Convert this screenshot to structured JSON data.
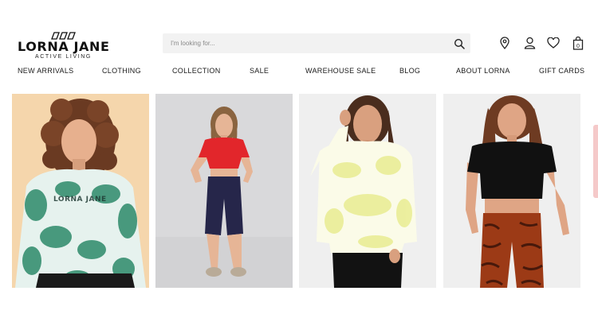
{
  "brand": {
    "name": "LORNA JANE",
    "tagline": "ACTIVE LIVING"
  },
  "search": {
    "placeholder": "I'm looking for..."
  },
  "header_icons": [
    "location-pin-icon",
    "account-icon",
    "heart-icon",
    "bag-icon"
  ],
  "bag": {
    "count": "0"
  },
  "nav": {
    "items": [
      {
        "label": "NEW ARRIVALS"
      },
      {
        "label": "CLOTHING"
      },
      {
        "label": "COLLECTION"
      },
      {
        "label": "SALE"
      },
      {
        "label": "WAREHOUSE SALE"
      },
      {
        "label": "BLOG"
      },
      {
        "label": "ABOUT LORNA"
      },
      {
        "label": "GIFT CARDS"
      }
    ]
  },
  "products": [
    {
      "image": "model-green-tie-dye-top",
      "print": "LORNA JANE"
    },
    {
      "image": "model-red-crop-top-navy-shorts"
    },
    {
      "image": "model-yellow-tie-dye-long-sleeve"
    },
    {
      "image": "model-black-crop-top-tiger-leggings"
    }
  ],
  "colors": {
    "accent": "#f5c9c9",
    "search_bg": "#f2f2f2",
    "text": "#1a1a1a"
  }
}
